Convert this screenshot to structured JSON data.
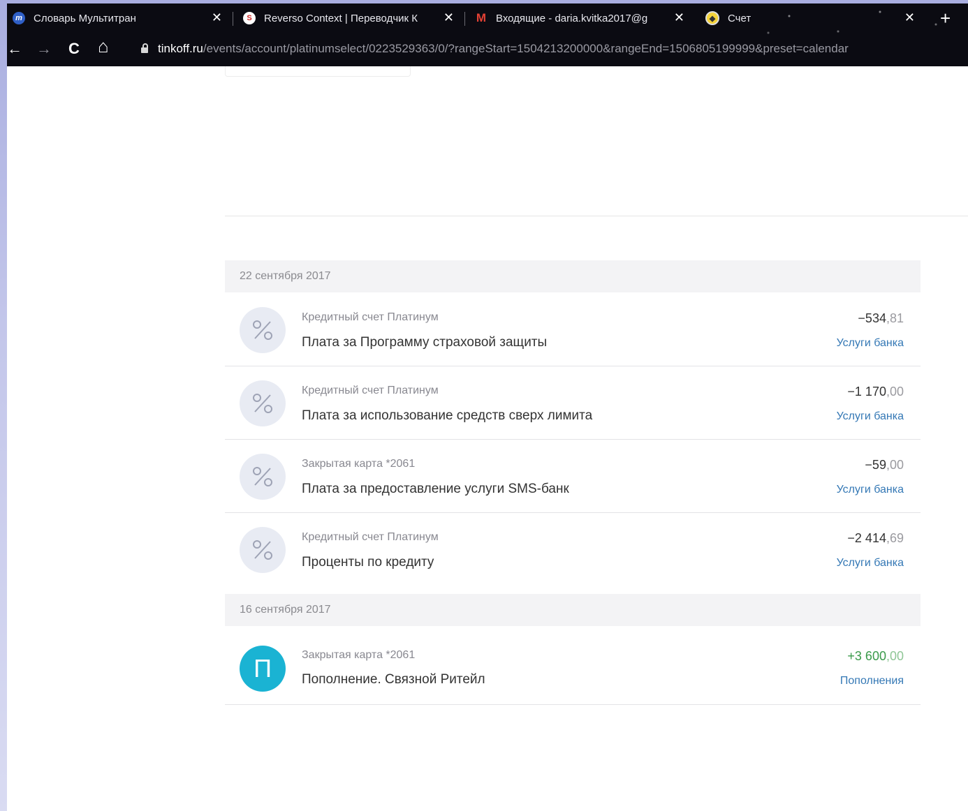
{
  "browser": {
    "tabs": [
      {
        "title": "Словарь Мультитран",
        "icon": "multitran-icon"
      },
      {
        "title": "Reverso Context | Переводчик К",
        "icon": "reverso-icon"
      },
      {
        "title": "Входящие - daria.kvitka2017@g",
        "icon": "gmail-icon"
      },
      {
        "title": "Счет",
        "icon": "tinkoff-icon"
      }
    ],
    "new_tab_glyph": "+",
    "close_glyph": "✕",
    "url_host": "tinkoff.ru",
    "url_path": "/events/account/platinumselect/0223529363/0/?rangeStart=1504213200000&rangeEnd=1506805199999&preset=calendar",
    "nav": {
      "back": "←",
      "forward": "→",
      "reload": "C",
      "home": "⌂"
    }
  },
  "groups": [
    {
      "date": "22 сентября 2017",
      "operations": [
        {
          "source": "Кредитный счет Платинум",
          "description": "Плата за Программу страховой защиты",
          "amount_int": "−534",
          "amount_dec": ",81",
          "category": "Услуги банка",
          "icon": "percent-icon"
        },
        {
          "source": "Кредитный счет Платинум",
          "description": "Плата за использование средств сверх лимита",
          "amount_int": "−1 170",
          "amount_dec": ",00",
          "category": "Услуги банка",
          "icon": "percent-icon"
        },
        {
          "source": "Закрытая карта *2061",
          "description": "Плата за предоставление услуги SMS-банк",
          "amount_int": "−59",
          "amount_dec": ",00",
          "category": "Услуги банка",
          "icon": "percent-icon"
        },
        {
          "source": "Кредитный счет Платинум",
          "description": "Проценты по кредиту",
          "amount_int": "−2 414",
          "amount_dec": ",69",
          "category": "Услуги банка",
          "icon": "percent-icon"
        }
      ]
    },
    {
      "date": "16 сентября 2017",
      "operations": [
        {
          "source": "Закрытая карта *2061",
          "description": "Пополнение. Связной Ритейл",
          "amount_int": "+3 600",
          "amount_dec": ",00",
          "category": "Пополнения",
          "icon": "letter-avatar",
          "avatar_letter": "П"
        }
      ]
    }
  ],
  "colors": {
    "accent_link": "#3478b5",
    "positive": "#3a9a4a",
    "avatar_blue": "#1ab3d3"
  }
}
